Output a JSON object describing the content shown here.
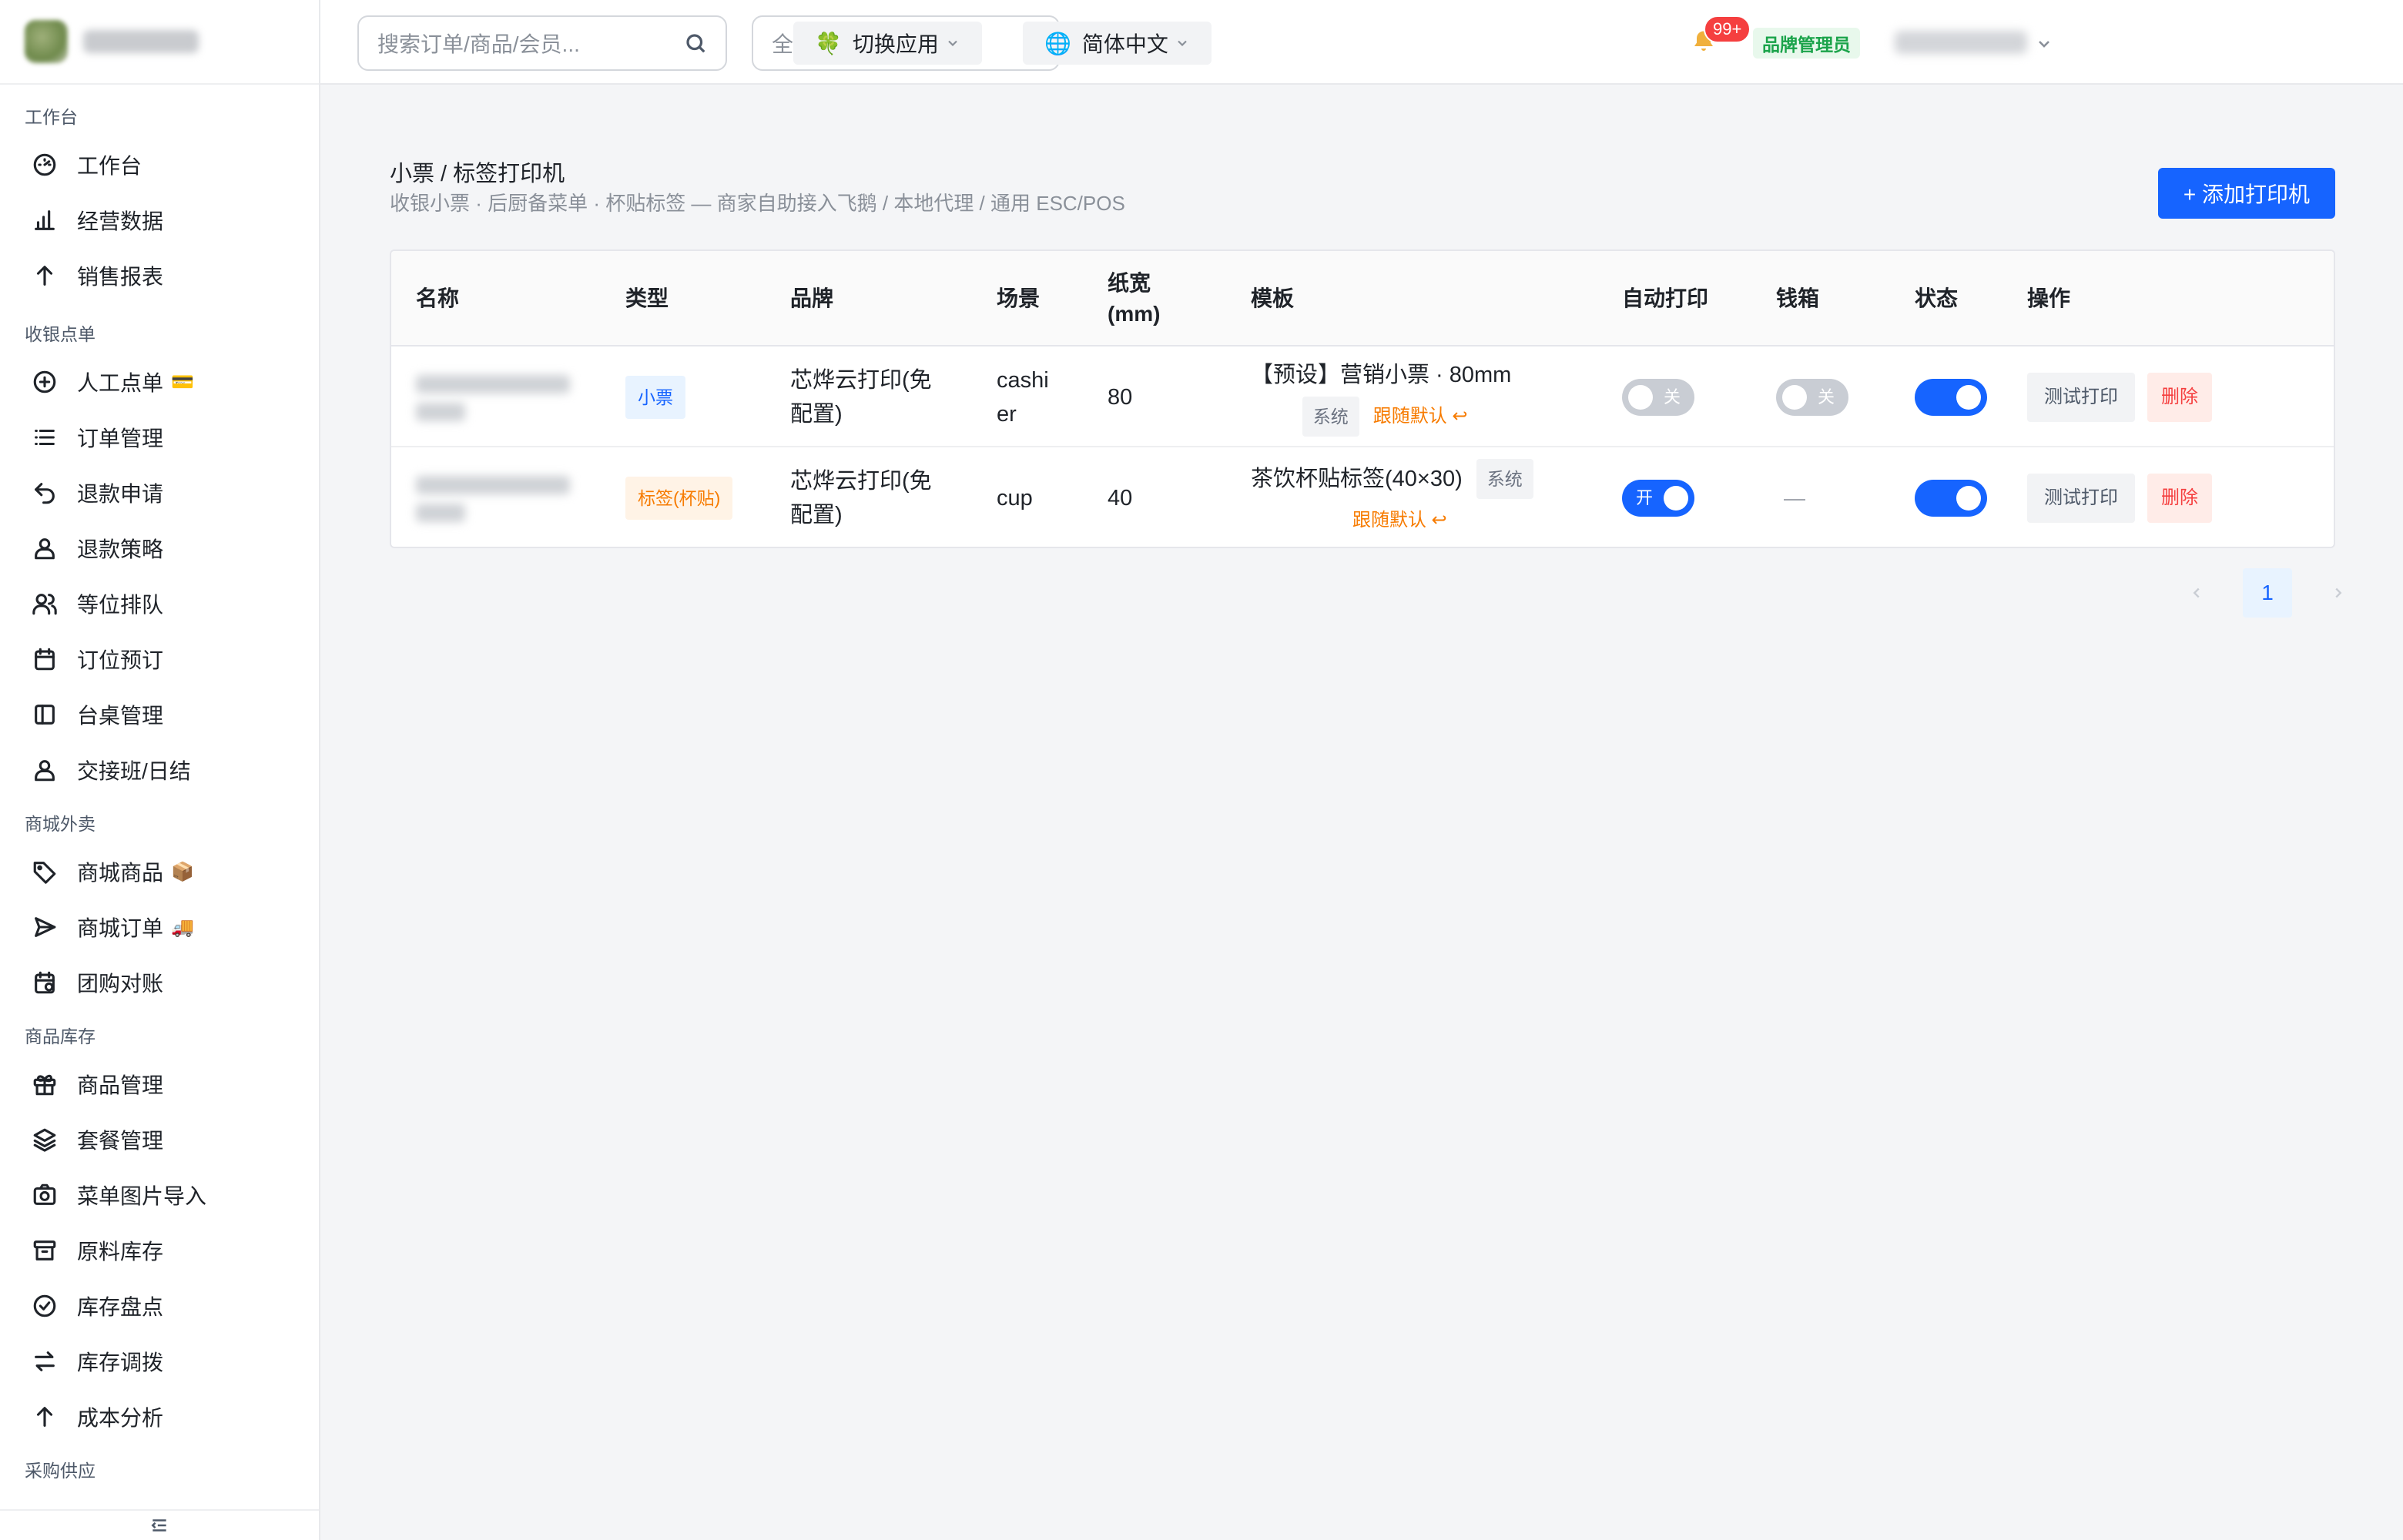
{
  "sidebar": {
    "groups": [
      {
        "title": "工作台",
        "items": [
          {
            "label": "工作台",
            "icon": "dashboard-icon"
          },
          {
            "label": "经营数据",
            "icon": "bar-chart-icon"
          },
          {
            "label": "销售报表",
            "icon": "arrow-up-icon"
          }
        ]
      },
      {
        "title": "收银点单",
        "items": [
          {
            "label": "人工点单",
            "icon": "plus-circle-icon",
            "emoji": "💳"
          },
          {
            "label": "订单管理",
            "icon": "list-icon"
          },
          {
            "label": "退款申请",
            "icon": "undo-icon"
          },
          {
            "label": "退款策略",
            "icon": "user-icon"
          },
          {
            "label": "等位排队",
            "icon": "users-icon"
          },
          {
            "label": "订位预订",
            "icon": "calendar-icon"
          },
          {
            "label": "台桌管理",
            "icon": "layout-icon"
          },
          {
            "label": "交接班/日结",
            "icon": "user-icon"
          }
        ]
      },
      {
        "title": "商城外卖",
        "items": [
          {
            "label": "商城商品",
            "icon": "tag-icon",
            "emoji": "📦"
          },
          {
            "label": "商城订单",
            "icon": "send-icon",
            "emoji": "🚚"
          },
          {
            "label": "团购对账",
            "icon": "calendar-check-icon"
          }
        ]
      },
      {
        "title": "商品库存",
        "items": [
          {
            "label": "商品管理",
            "icon": "gift-icon"
          },
          {
            "label": "套餐管理",
            "icon": "layers-icon"
          },
          {
            "label": "菜单图片导入",
            "icon": "camera-icon"
          },
          {
            "label": "原料库存",
            "icon": "archive-icon"
          },
          {
            "label": "库存盘点",
            "icon": "check-circle-icon"
          },
          {
            "label": "库存调拨",
            "icon": "swap-icon"
          },
          {
            "label": "成本分析",
            "icon": "arrow-up-icon"
          }
        ]
      },
      {
        "title": "采购供应",
        "items": []
      }
    ]
  },
  "header": {
    "search_placeholder": "搜索订单/商品/会员...",
    "store_select": "全部门店",
    "switch_app": "切换应用",
    "switch_app_icon": "🍀",
    "language": "简体中文",
    "language_icon": "🌐",
    "notif_badge": "99+",
    "role": "品牌管理员"
  },
  "page": {
    "title": "小票 / 标签打印机",
    "subtitle": "收银小票 · 后厨备菜单 · 杯贴标签 — 商家自助接入飞鹅 / 本地代理 / 通用 ESC/POS",
    "add_button": "+ 添加打印机"
  },
  "table": {
    "headers": {
      "name": "名称",
      "type": "类型",
      "brand": "品牌",
      "scene": "场景",
      "width_l1": "纸宽",
      "width_l2": "(mm)",
      "template": "模板",
      "auto": "自动打印",
      "drawer": "钱箱",
      "status": "状态",
      "ops": "操作"
    },
    "rows": [
      {
        "type": "小票",
        "brand_l1": "芯烨云打印(免",
        "brand_l2": "配置)",
        "scene_l1": "cashi",
        "scene_l2": "er",
        "width": "80",
        "template": "【预设】营销小票 · 80mm",
        "sys_tag": "系统",
        "follow": "跟随默认 ↩",
        "auto_label": "关",
        "drawer_label": "关",
        "test": "测试打印",
        "delete": "删除"
      },
      {
        "type": "标签(杯贴)",
        "brand_l1": "芯烨云打印(免",
        "brand_l2": "配置)",
        "scene_l1": "cup",
        "width": "40",
        "template": "茶饮杯贴标签(40×30)",
        "sys_tag": "系统",
        "follow": "跟随默认 ↩",
        "auto_label": "开",
        "drawer_label": "—",
        "test": "测试打印",
        "delete": "删除"
      }
    ]
  },
  "pagination": {
    "current": "1"
  }
}
